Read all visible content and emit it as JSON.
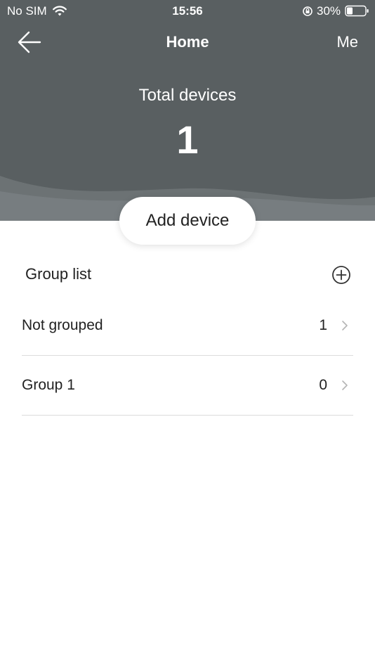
{
  "status_bar": {
    "carrier": "No SIM",
    "time": "15:56",
    "battery": "30%",
    "icons": [
      "wifi-icon",
      "rotation-lock-icon",
      "battery-icon"
    ]
  },
  "nav": {
    "back_icon": "back-arrow-icon",
    "title": "Home",
    "me": "Me"
  },
  "summary": {
    "label": "Total devices",
    "count": "1"
  },
  "add_device": {
    "label": "Add device"
  },
  "groups": {
    "title": "Group list",
    "add_icon": "plus-circle-icon",
    "items": [
      {
        "label": "Not grouped",
        "count": "1"
      },
      {
        "label": "Group 1",
        "count": "0"
      }
    ]
  },
  "colors": {
    "header_bg": "#595f61",
    "header_wave": "#72787a",
    "divider": "#dcdcdc"
  }
}
